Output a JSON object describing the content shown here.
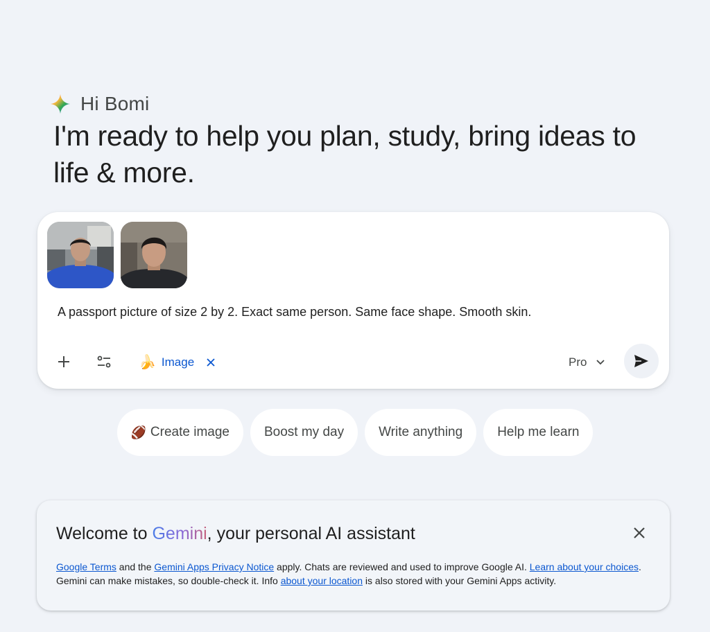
{
  "greeting": {
    "hi": "Hi Bomi",
    "headline": "I'm ready to help you plan, study, bring ideas to life & more."
  },
  "prompt": {
    "attachments": [
      {
        "alt": "Selfie photo in car, blue sweater"
      },
      {
        "alt": "Selfie photo, close-up, dark jacket"
      }
    ],
    "text": "A passport picture of size 2 by 2. Exact same person. Same face shape. Smooth skin.",
    "toolbar": {
      "add_icon": "plus-icon",
      "tools_icon": "tune-icon",
      "image_tool": {
        "emoji": "🍌",
        "label": "Image",
        "close": "×"
      },
      "model": "Pro",
      "send_icon": "send-icon"
    }
  },
  "suggestions": [
    {
      "emoji": "🏈",
      "label": "Create image"
    },
    {
      "emoji": "",
      "label": "Boost my day"
    },
    {
      "emoji": "",
      "label": "Write anything"
    },
    {
      "emoji": "",
      "label": "Help me learn"
    }
  ],
  "welcome": {
    "title_prefix": "Welcome to ",
    "title_brand": "Gemini",
    "title_suffix": ", your personal AI assistant",
    "links": {
      "terms": "Google Terms",
      "privacy": "Gemini Apps Privacy Notice",
      "choices": "Learn about your choices",
      "location": "about your location"
    },
    "text": {
      "and_the": " and the ",
      "apply": " apply. Chats are reviewed and used to improve Google AI. ",
      "mistakes": ". Gemini can make mistakes, so double-check it. Info ",
      "stored": " is also stored with your Gemini Apps activity."
    }
  },
  "colors": {
    "background": "#f0f3f8",
    "link": "#0b57d0",
    "card": "#ffffff"
  }
}
